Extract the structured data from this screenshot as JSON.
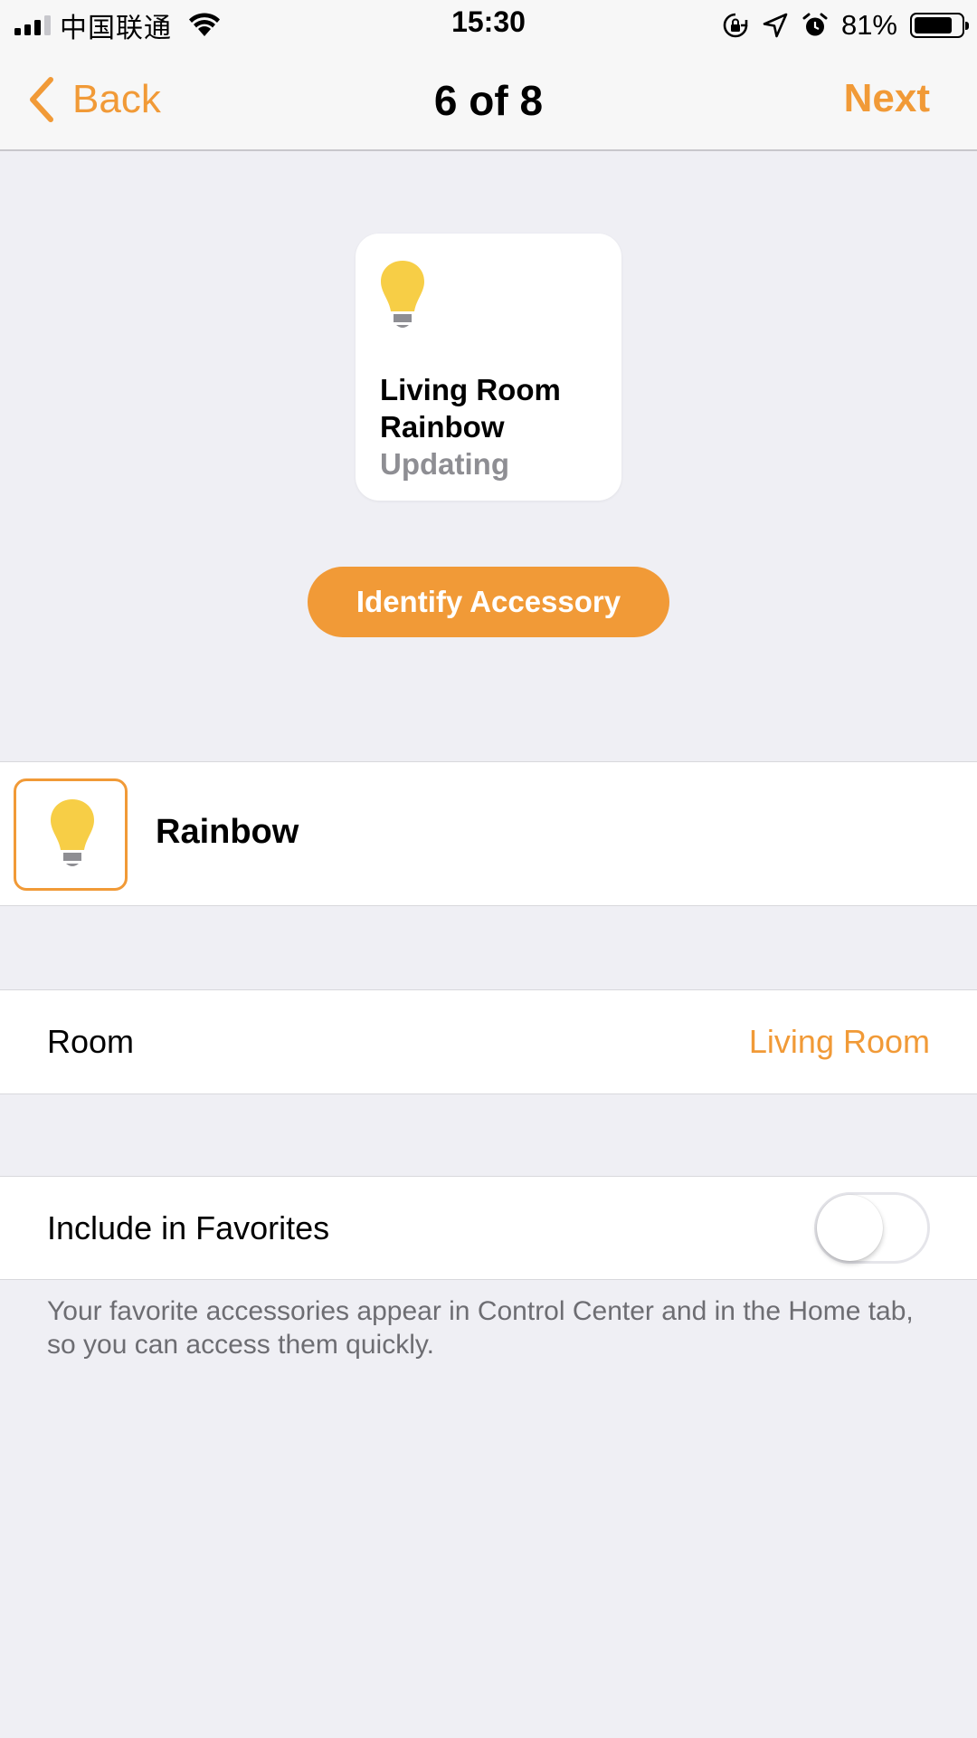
{
  "status_bar": {
    "carrier": "中国联通",
    "time": "15:30",
    "battery_percent": "81%",
    "battery_level": 0.81,
    "icons": [
      "signal-icon",
      "wifi-icon",
      "orientation-lock-icon",
      "location-icon",
      "alarm-icon",
      "battery-icon"
    ]
  },
  "nav": {
    "back_label": "Back",
    "title": "6 of 8",
    "next_label": "Next"
  },
  "tile": {
    "name": "Living Room Rainbow",
    "status": "Updating",
    "icon": "lightbulb-icon"
  },
  "identify_button": "Identify Accessory",
  "name_row": {
    "value": "Rainbow",
    "icon": "lightbulb-icon"
  },
  "room_row": {
    "label": "Room",
    "value": "Living Room"
  },
  "favorites_row": {
    "label": "Include in Favorites",
    "enabled": false,
    "note": "Your favorite accessories appear in Control Center and in the Home tab, so you can access them quickly."
  },
  "colors": {
    "accent": "#f19a37",
    "bulb": "#f7ce46",
    "background": "#efeff4",
    "secondary_text": "#8e8e93"
  }
}
